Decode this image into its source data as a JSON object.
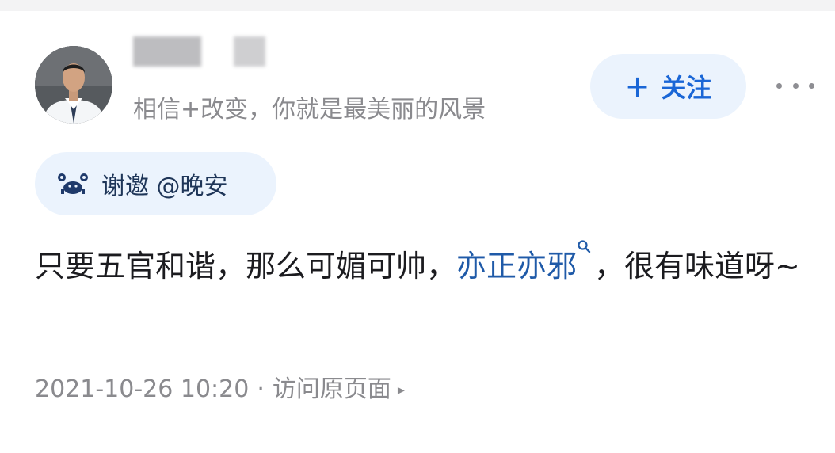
{
  "author": {
    "bio": "相信+改变，你就是最美丽的风景"
  },
  "actions": {
    "follow_plus": "+",
    "follow_label": "关注",
    "more_label": "更多"
  },
  "invite": {
    "text": "谢邀 @晚安"
  },
  "post": {
    "text_before": "只要五官和谐，那么可媚可帅，",
    "link_text": "亦正亦邪",
    "text_after": "，很有味道呀~"
  },
  "meta": {
    "timestamp": "2021-10-26 10:20",
    "separator": "·",
    "view_source": "访问原页面",
    "arrow": "▸"
  },
  "colors": {
    "accent": "#1a66d6",
    "link": "#1f5aa8",
    "pill_bg": "#ebf3fd",
    "muted": "#8a8a8e",
    "body_text": "#1b1b1f"
  },
  "icons": {
    "more": "ellipsis-icon",
    "invite": "crab-icon",
    "search": "search-icon",
    "arrow": "triangle-right-icon"
  }
}
